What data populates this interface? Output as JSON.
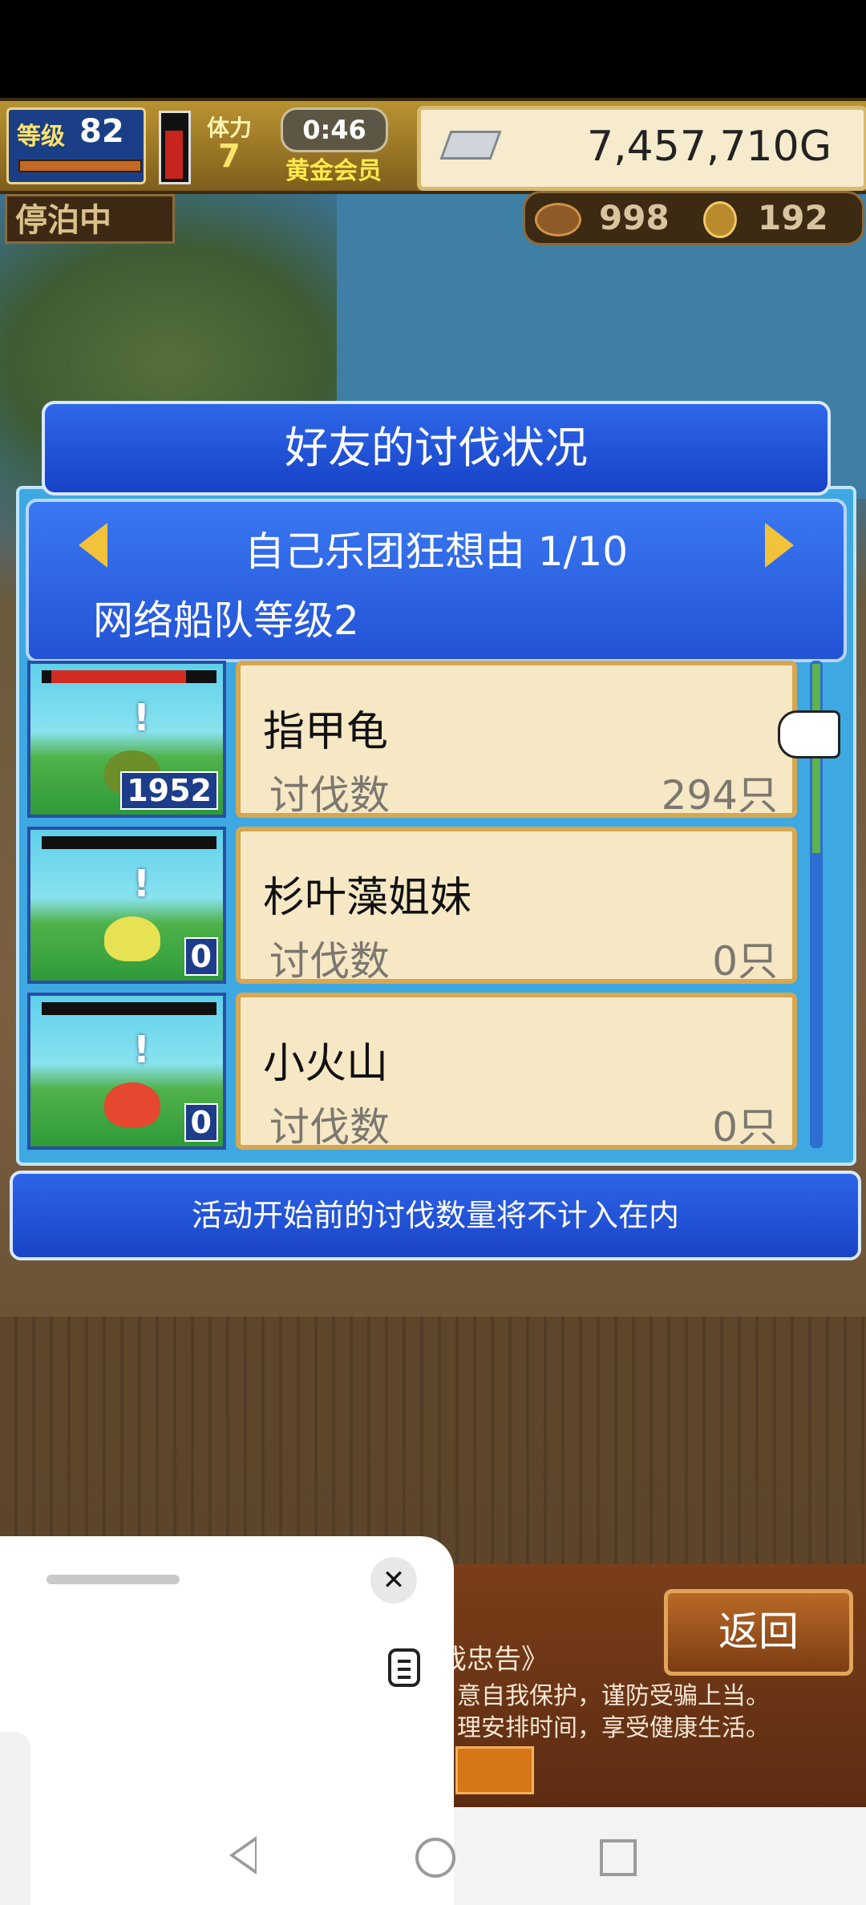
{
  "status": {
    "level_label": "等级",
    "level_value": "82",
    "stamina_label": "体力",
    "stamina_value": "7",
    "timer": "0:46",
    "membership": "黄金会员",
    "gold": "7,457,710G",
    "anchor_status": "停泊中",
    "resource_1": "998",
    "resource_2": "192"
  },
  "dialog": {
    "title": "好友的讨伐状况",
    "group_title": "自己乐团狂想由 1/10",
    "group_subtitle": "网络船队等级2",
    "list": [
      {
        "name": "指甲龟",
        "kill_label": "讨伐数",
        "kills": "294只",
        "badge": "1952"
      },
      {
        "name": "杉叶藻姐妹",
        "kill_label": "讨伐数",
        "kills": "0只",
        "badge": "0"
      },
      {
        "name": "小火山",
        "kill_label": "讨伐数",
        "kills": "0只",
        "badge": "0"
      }
    ],
    "notice": "活动开始前的讨伐数量将不计入在内"
  },
  "footer": {
    "back_button": "返回",
    "advice_title": "戏忠告》",
    "advice_line1": "意自我保护，谨防受骗上当。",
    "advice_line2": "理安排时间，享受健康生活。"
  },
  "sheet": {
    "close": "✕"
  },
  "colors": {
    "panel_blue": "#2d64e8",
    "card_beige": "#f6e8c5",
    "gold_text": "#ffe36a"
  }
}
